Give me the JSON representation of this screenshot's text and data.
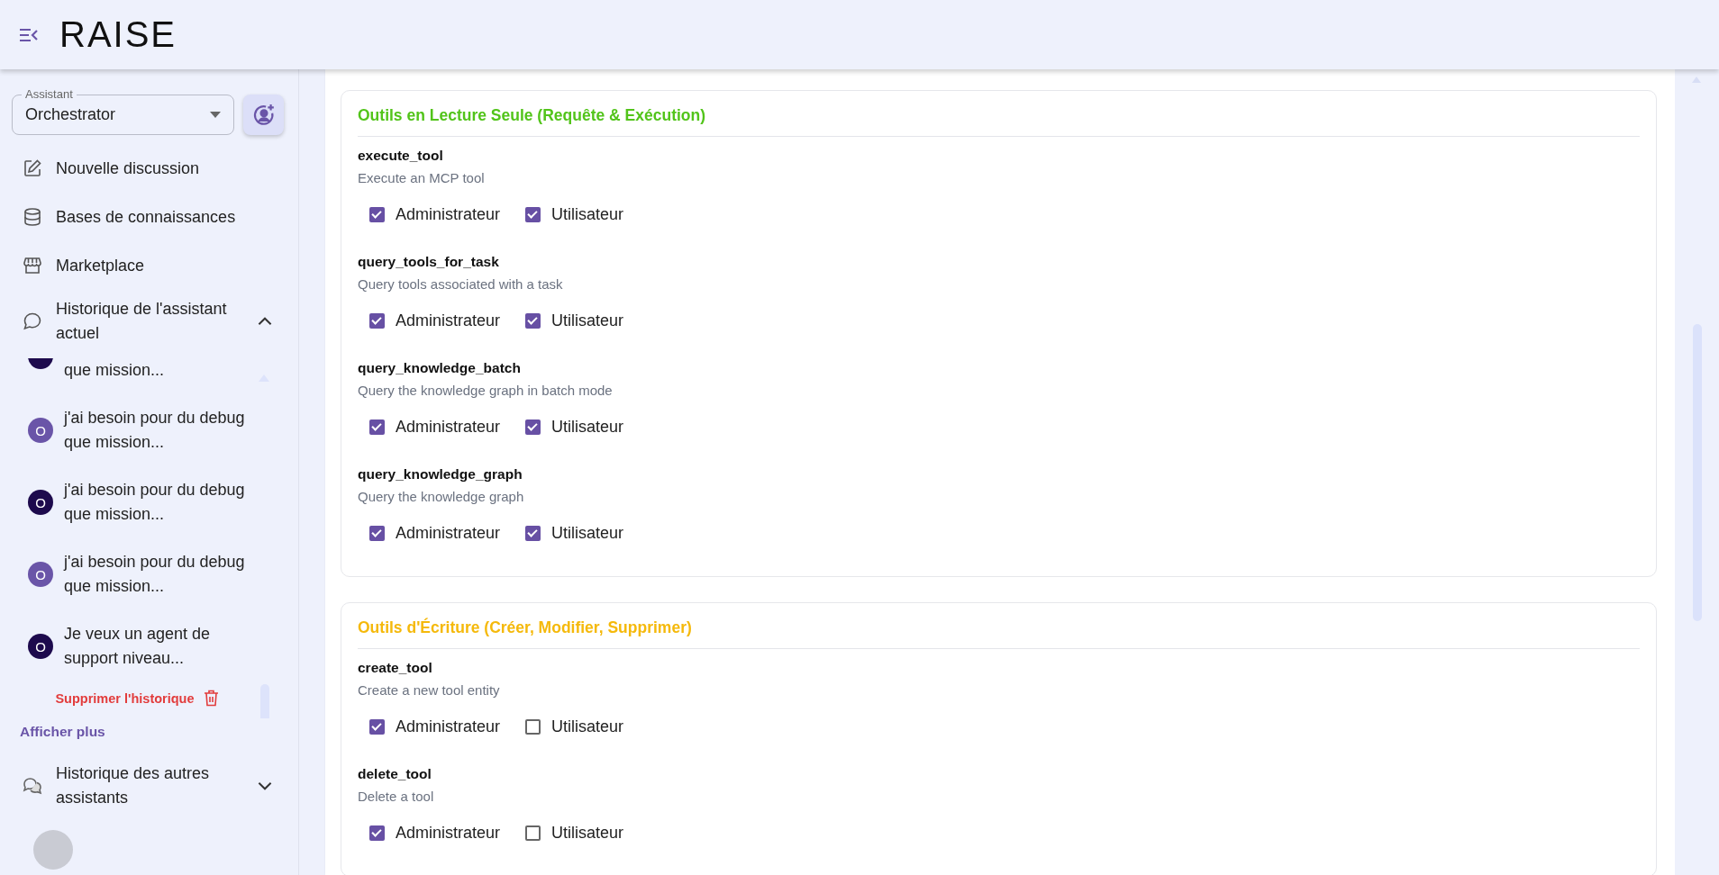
{
  "header": {
    "logo": "RAISE"
  },
  "sidebar": {
    "assistant_select": {
      "label": "Assistant",
      "value": "Orchestrator"
    },
    "nav": [
      {
        "kind": "new",
        "label": "Nouvelle discussion"
      },
      {
        "kind": "knowledge",
        "label": "Bases de connaissances"
      },
      {
        "kind": "marketplace",
        "label": "Marketplace"
      }
    ],
    "current_history": {
      "label": "Historique de l'assistant actuel",
      "expanded": true,
      "items": [
        {
          "text": "que mission...",
          "color": "#1d0a4d"
        },
        {
          "initial": "O",
          "text": "j'ai besoin pour du debug que mission...",
          "color": "#6a55a8"
        },
        {
          "initial": "O",
          "text": "j'ai besoin pour du debug que mission...",
          "color": "#1d0a4d"
        },
        {
          "initial": "O",
          "text": "j'ai besoin pour du debug que mission...",
          "color": "#6a55a8"
        },
        {
          "initial": "O",
          "text": "Je veux un agent de support niveau...",
          "color": "#1d0a4d"
        }
      ],
      "clear_label": "Supprimer l'historique"
    },
    "show_more": "Afficher plus",
    "other_history": {
      "label": "Historique des autres assistants",
      "expanded": false
    }
  },
  "sections": [
    {
      "title": "Outils en Lecture Seule (Requête & Exécution)",
      "color": "#52c41a",
      "tools": [
        {
          "name": "execute_tool",
          "description": "Execute an MCP tool",
          "roles": [
            {
              "label": "Administrateur",
              "checked": true
            },
            {
              "label": "Utilisateur",
              "checked": true
            }
          ]
        },
        {
          "name": "query_tools_for_task",
          "description": "Query tools associated with a task",
          "roles": [
            {
              "label": "Administrateur",
              "checked": true
            },
            {
              "label": "Utilisateur",
              "checked": true
            }
          ]
        },
        {
          "name": "query_knowledge_batch",
          "description": "Query the knowledge graph in batch mode",
          "roles": [
            {
              "label": "Administrateur",
              "checked": true
            },
            {
              "label": "Utilisateur",
              "checked": true
            }
          ]
        },
        {
          "name": "query_knowledge_graph",
          "description": "Query the knowledge graph",
          "roles": [
            {
              "label": "Administrateur",
              "checked": true
            },
            {
              "label": "Utilisateur",
              "checked": true
            }
          ]
        }
      ]
    },
    {
      "title": "Outils d'Écriture (Créer, Modifier, Supprimer)",
      "color": "#f5b90b",
      "tools": [
        {
          "name": "create_tool",
          "description": "Create a new tool entity",
          "roles": [
            {
              "label": "Administrateur",
              "checked": true
            },
            {
              "label": "Utilisateur",
              "checked": false
            }
          ]
        },
        {
          "name": "delete_tool",
          "description": "Delete a tool",
          "roles": [
            {
              "label": "Administrateur",
              "checked": true
            },
            {
              "label": "Utilisateur",
              "checked": false
            }
          ]
        }
      ]
    }
  ]
}
